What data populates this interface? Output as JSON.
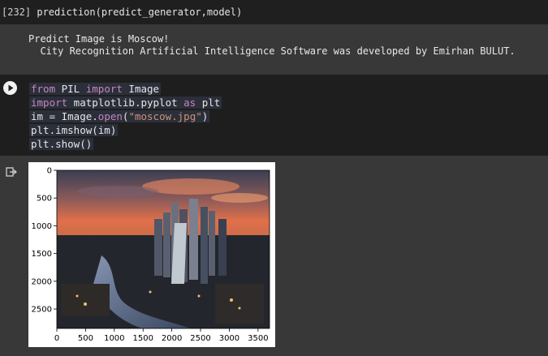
{
  "cell1": {
    "prompt": "[232]",
    "code": "prediction(predict_generator,model)"
  },
  "output1": {
    "line1": "Predict Image is Moscow!",
    "line2": "  City Recognition Artificial Intelligence Software was developed by Emirhan BULUT."
  },
  "cell2": {
    "lines": [
      [
        {
          "t": "from",
          "c": "kw"
        },
        {
          "t": " PIL ",
          "c": ""
        },
        {
          "t": "import",
          "c": "kw"
        },
        {
          "t": " Image",
          "c": ""
        }
      ],
      [
        {
          "t": "import",
          "c": "kw"
        },
        {
          "t": " matplotlib.pyplot ",
          "c": ""
        },
        {
          "t": "as",
          "c": "kw"
        },
        {
          "t": " plt",
          "c": ""
        }
      ],
      [
        {
          "t": "im = Image.",
          "c": ""
        },
        {
          "t": "open",
          "c": "kw"
        },
        {
          "t": "(",
          "c": ""
        },
        {
          "t": "\"moscow.jpg\"",
          "c": "str"
        },
        {
          "t": ")",
          "c": ""
        }
      ],
      [
        {
          "t": "plt.imshow(im)",
          "c": ""
        }
      ],
      [
        {
          "t": "plt.show()",
          "c": ""
        }
      ]
    ]
  },
  "plot": {
    "y_ticks": [
      "0",
      "500",
      "1000",
      "1500",
      "2000",
      "2500"
    ],
    "x_ticks": [
      "0",
      "500",
      "1000",
      "1500",
      "2000",
      "2500",
      "3000",
      "3500"
    ],
    "image_description": "Aerial photo of Moscow City skyscrapers at sunset"
  },
  "colors": {
    "keyword": "#c586c0",
    "string": "#ce9178",
    "cell_bg": "#1e1e1e",
    "output_bg": "#383838"
  }
}
